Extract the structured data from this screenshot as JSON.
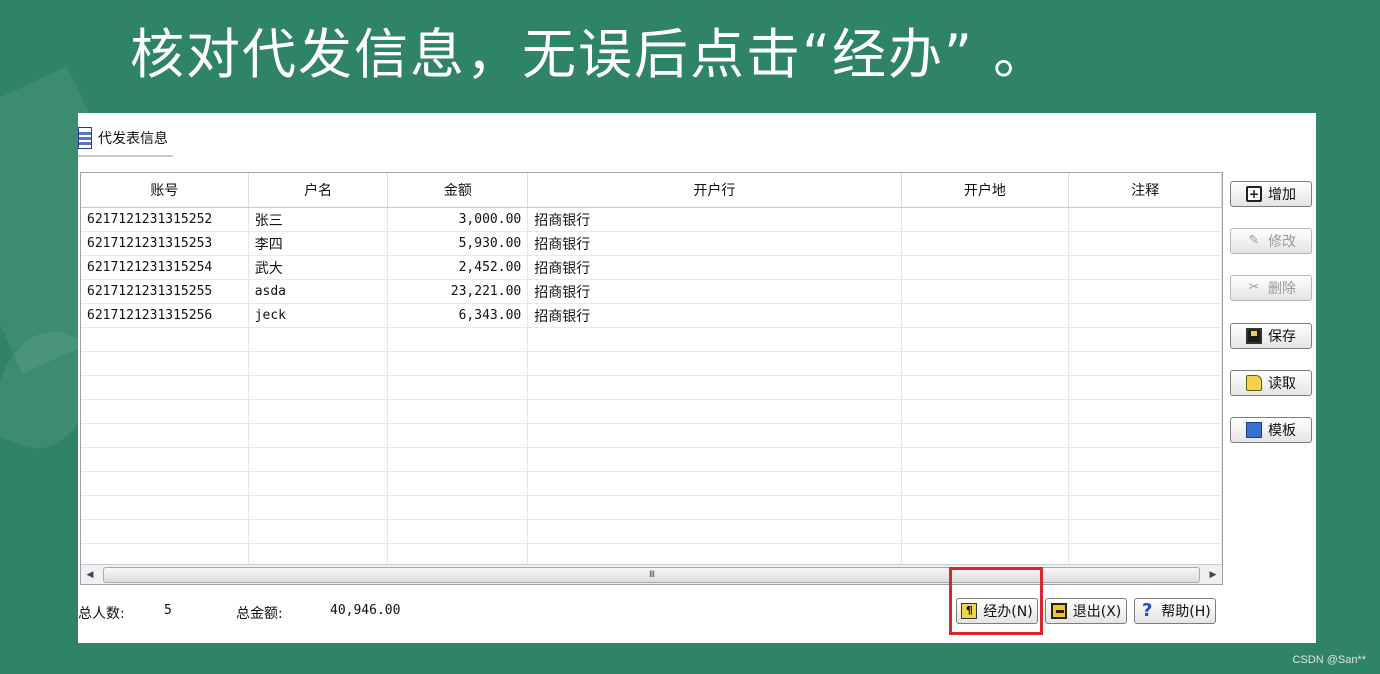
{
  "slide": {
    "title": "核对代发信息，无误后点击“经办” 。",
    "watermark": "CSDN @San**"
  },
  "window": {
    "tab_title": "代发表信息"
  },
  "grid": {
    "columns": [
      "账号",
      "户名",
      "金额",
      "开户行",
      "开户地",
      "注释"
    ],
    "rows": [
      {
        "account": "6217121231315252",
        "name": "张三",
        "amount": "3,000.00",
        "bank": "招商银行",
        "location": "",
        "note": ""
      },
      {
        "account": "6217121231315253",
        "name": "李四",
        "amount": "5,930.00",
        "bank": "招商银行",
        "location": "",
        "note": ""
      },
      {
        "account": "6217121231315254",
        "name": "武大",
        "amount": "2,452.00",
        "bank": "招商银行",
        "location": "",
        "note": ""
      },
      {
        "account": "6217121231315255",
        "name": "asda",
        "amount": "23,221.00",
        "bank": "招商银行",
        "location": "",
        "note": ""
      },
      {
        "account": "6217121231315256",
        "name": "jeck",
        "amount": "6,343.00",
        "bank": "招商银行",
        "location": "",
        "note": ""
      }
    ],
    "scroll_grip": "III"
  },
  "side_buttons": {
    "add": "增加",
    "edit": "修改",
    "delete": "删除",
    "save": "保存",
    "read": "读取",
    "template": "模板"
  },
  "footer": {
    "total_people_label": "总人数:",
    "total_people": "5",
    "total_amount_label": "总金额:",
    "total_amount": "40,946.00"
  },
  "bottom_buttons": {
    "handle": "经办(N)",
    "exit": "退出(X)",
    "help": "帮助(H)"
  },
  "colors": {
    "background": "#2f8466",
    "highlight": "#d8262c"
  },
  "icons": {
    "add": "add-icon",
    "edit": "pencil-icon",
    "delete": "scissors-icon",
    "save": "floppy-disk-icon",
    "read": "folder-open-icon",
    "template": "template-icon",
    "handle": "document-pen-icon",
    "exit": "exit-door-icon",
    "help": "help-icon"
  }
}
